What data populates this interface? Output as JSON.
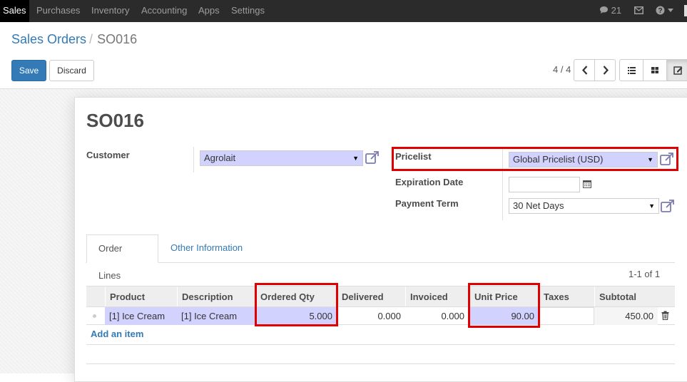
{
  "navbar": {
    "menu": [
      "Sales",
      "Purchases",
      "Inventory",
      "Accounting",
      "Apps",
      "Settings"
    ],
    "messages_count": "21"
  },
  "breadcrumb": {
    "parent": "Sales Orders",
    "current": "SO016"
  },
  "buttons": {
    "save": "Save",
    "discard": "Discard"
  },
  "pager": {
    "value": "4 / 4"
  },
  "form": {
    "title": "SO016",
    "customer_label": "Customer",
    "customer_value": "Agrolait",
    "pricelist_label": "Pricelist",
    "pricelist_value": "Global Pricelist (USD)",
    "expiration_label": "Expiration Date",
    "expiration_value": "",
    "payment_term_label": "Payment Term",
    "payment_term_value": "30 Net Days"
  },
  "tabs": [
    "Order Lines",
    "Other Information"
  ],
  "list_pager": "1-1 of 1",
  "table": {
    "headers": [
      "Product",
      "Description",
      "Ordered Qty",
      "Delivered",
      "Invoiced",
      "Unit Price",
      "Taxes",
      "Subtotal"
    ],
    "rows": [
      {
        "product": "[1] Ice Cream",
        "description": "[1] Ice Cream",
        "ordered_qty": "5.000",
        "delivered": "0.000",
        "invoiced": "0.000",
        "unit_price": "90.00",
        "taxes": "",
        "subtotal": "450.00"
      }
    ],
    "add_item": "Add an item"
  },
  "colors": {
    "highlight": "#e00000",
    "primary": "#337ab7",
    "required_field": "#d2d2ff"
  }
}
